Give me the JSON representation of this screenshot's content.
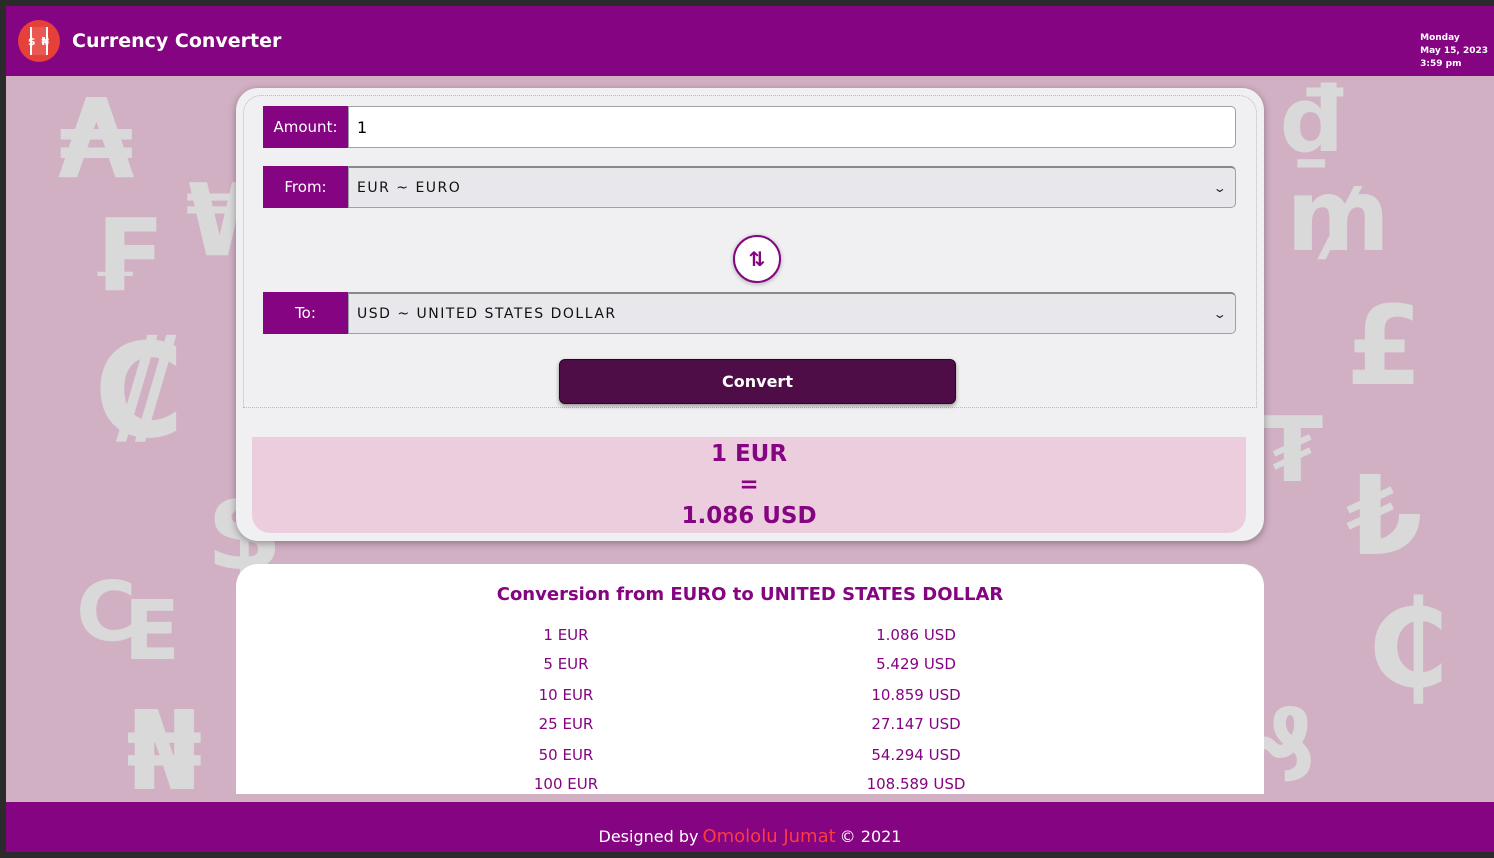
{
  "header": {
    "logo_text": "$ ₦",
    "title": "Currency Converter",
    "day": "Monday",
    "date": "May 15, 2023",
    "time": "3:59 pm"
  },
  "form": {
    "amount_label": "Amount:",
    "amount_value": "1",
    "from_label": "From:",
    "from_selected": "EUR ~ EURO",
    "to_label": "To:",
    "to_selected": "USD ~ UNITED STATES DOLLAR",
    "swap_icon": "⇅",
    "convert_label": "Convert"
  },
  "result": {
    "from_text": "1 EUR",
    "equals": "=",
    "to_text": "1.086 USD"
  },
  "table": {
    "title": "Conversion from EURO to UNITED STATES DOLLAR",
    "rows": [
      {
        "from": "1 EUR",
        "to": "1.086 USD"
      },
      {
        "from": "5 EUR",
        "to": "5.429 USD"
      },
      {
        "from": "10 EUR",
        "to": "10.859 USD"
      },
      {
        "from": "25 EUR",
        "to": "27.147 USD"
      },
      {
        "from": "50 EUR",
        "to": "54.294 USD"
      },
      {
        "from": "100 EUR",
        "to": "108.589 USD"
      }
    ]
  },
  "footer": {
    "prefix": "Designed by",
    "author": "Omololu Jumat",
    "suffix": "© 2021"
  },
  "colors": {
    "brand": "#850481",
    "button": "#4f0d47",
    "result_bg": "#ebcddd",
    "page_bg": "#d2b0c4",
    "author": "#ff3b3b"
  }
}
